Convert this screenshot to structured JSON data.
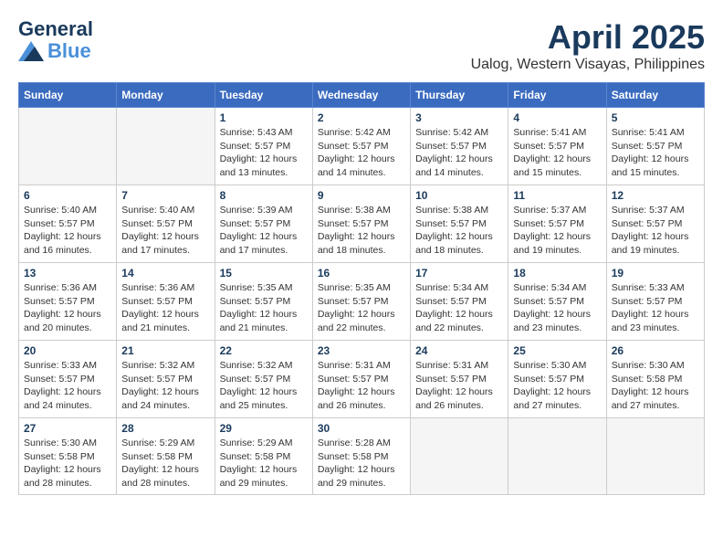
{
  "header": {
    "logo_line1": "General",
    "logo_line2": "Blue",
    "month": "April 2025",
    "location": "Ualog, Western Visayas, Philippines"
  },
  "weekdays": [
    "Sunday",
    "Monday",
    "Tuesday",
    "Wednesday",
    "Thursday",
    "Friday",
    "Saturday"
  ],
  "weeks": [
    [
      {
        "day": "",
        "info": ""
      },
      {
        "day": "",
        "info": ""
      },
      {
        "day": "1",
        "info": "Sunrise: 5:43 AM\nSunset: 5:57 PM\nDaylight: 12 hours\nand 13 minutes."
      },
      {
        "day": "2",
        "info": "Sunrise: 5:42 AM\nSunset: 5:57 PM\nDaylight: 12 hours\nand 14 minutes."
      },
      {
        "day": "3",
        "info": "Sunrise: 5:42 AM\nSunset: 5:57 PM\nDaylight: 12 hours\nand 14 minutes."
      },
      {
        "day": "4",
        "info": "Sunrise: 5:41 AM\nSunset: 5:57 PM\nDaylight: 12 hours\nand 15 minutes."
      },
      {
        "day": "5",
        "info": "Sunrise: 5:41 AM\nSunset: 5:57 PM\nDaylight: 12 hours\nand 15 minutes."
      }
    ],
    [
      {
        "day": "6",
        "info": "Sunrise: 5:40 AM\nSunset: 5:57 PM\nDaylight: 12 hours\nand 16 minutes."
      },
      {
        "day": "7",
        "info": "Sunrise: 5:40 AM\nSunset: 5:57 PM\nDaylight: 12 hours\nand 17 minutes."
      },
      {
        "day": "8",
        "info": "Sunrise: 5:39 AM\nSunset: 5:57 PM\nDaylight: 12 hours\nand 17 minutes."
      },
      {
        "day": "9",
        "info": "Sunrise: 5:38 AM\nSunset: 5:57 PM\nDaylight: 12 hours\nand 18 minutes."
      },
      {
        "day": "10",
        "info": "Sunrise: 5:38 AM\nSunset: 5:57 PM\nDaylight: 12 hours\nand 18 minutes."
      },
      {
        "day": "11",
        "info": "Sunrise: 5:37 AM\nSunset: 5:57 PM\nDaylight: 12 hours\nand 19 minutes."
      },
      {
        "day": "12",
        "info": "Sunrise: 5:37 AM\nSunset: 5:57 PM\nDaylight: 12 hours\nand 19 minutes."
      }
    ],
    [
      {
        "day": "13",
        "info": "Sunrise: 5:36 AM\nSunset: 5:57 PM\nDaylight: 12 hours\nand 20 minutes."
      },
      {
        "day": "14",
        "info": "Sunrise: 5:36 AM\nSunset: 5:57 PM\nDaylight: 12 hours\nand 21 minutes."
      },
      {
        "day": "15",
        "info": "Sunrise: 5:35 AM\nSunset: 5:57 PM\nDaylight: 12 hours\nand 21 minutes."
      },
      {
        "day": "16",
        "info": "Sunrise: 5:35 AM\nSunset: 5:57 PM\nDaylight: 12 hours\nand 22 minutes."
      },
      {
        "day": "17",
        "info": "Sunrise: 5:34 AM\nSunset: 5:57 PM\nDaylight: 12 hours\nand 22 minutes."
      },
      {
        "day": "18",
        "info": "Sunrise: 5:34 AM\nSunset: 5:57 PM\nDaylight: 12 hours\nand 23 minutes."
      },
      {
        "day": "19",
        "info": "Sunrise: 5:33 AM\nSunset: 5:57 PM\nDaylight: 12 hours\nand 23 minutes."
      }
    ],
    [
      {
        "day": "20",
        "info": "Sunrise: 5:33 AM\nSunset: 5:57 PM\nDaylight: 12 hours\nand 24 minutes."
      },
      {
        "day": "21",
        "info": "Sunrise: 5:32 AM\nSunset: 5:57 PM\nDaylight: 12 hours\nand 24 minutes."
      },
      {
        "day": "22",
        "info": "Sunrise: 5:32 AM\nSunset: 5:57 PM\nDaylight: 12 hours\nand 25 minutes."
      },
      {
        "day": "23",
        "info": "Sunrise: 5:31 AM\nSunset: 5:57 PM\nDaylight: 12 hours\nand 26 minutes."
      },
      {
        "day": "24",
        "info": "Sunrise: 5:31 AM\nSunset: 5:57 PM\nDaylight: 12 hours\nand 26 minutes."
      },
      {
        "day": "25",
        "info": "Sunrise: 5:30 AM\nSunset: 5:57 PM\nDaylight: 12 hours\nand 27 minutes."
      },
      {
        "day": "26",
        "info": "Sunrise: 5:30 AM\nSunset: 5:58 PM\nDaylight: 12 hours\nand 27 minutes."
      }
    ],
    [
      {
        "day": "27",
        "info": "Sunrise: 5:30 AM\nSunset: 5:58 PM\nDaylight: 12 hours\nand 28 minutes."
      },
      {
        "day": "28",
        "info": "Sunrise: 5:29 AM\nSunset: 5:58 PM\nDaylight: 12 hours\nand 28 minutes."
      },
      {
        "day": "29",
        "info": "Sunrise: 5:29 AM\nSunset: 5:58 PM\nDaylight: 12 hours\nand 29 minutes."
      },
      {
        "day": "30",
        "info": "Sunrise: 5:28 AM\nSunset: 5:58 PM\nDaylight: 12 hours\nand 29 minutes."
      },
      {
        "day": "",
        "info": ""
      },
      {
        "day": "",
        "info": ""
      },
      {
        "day": "",
        "info": ""
      }
    ]
  ]
}
